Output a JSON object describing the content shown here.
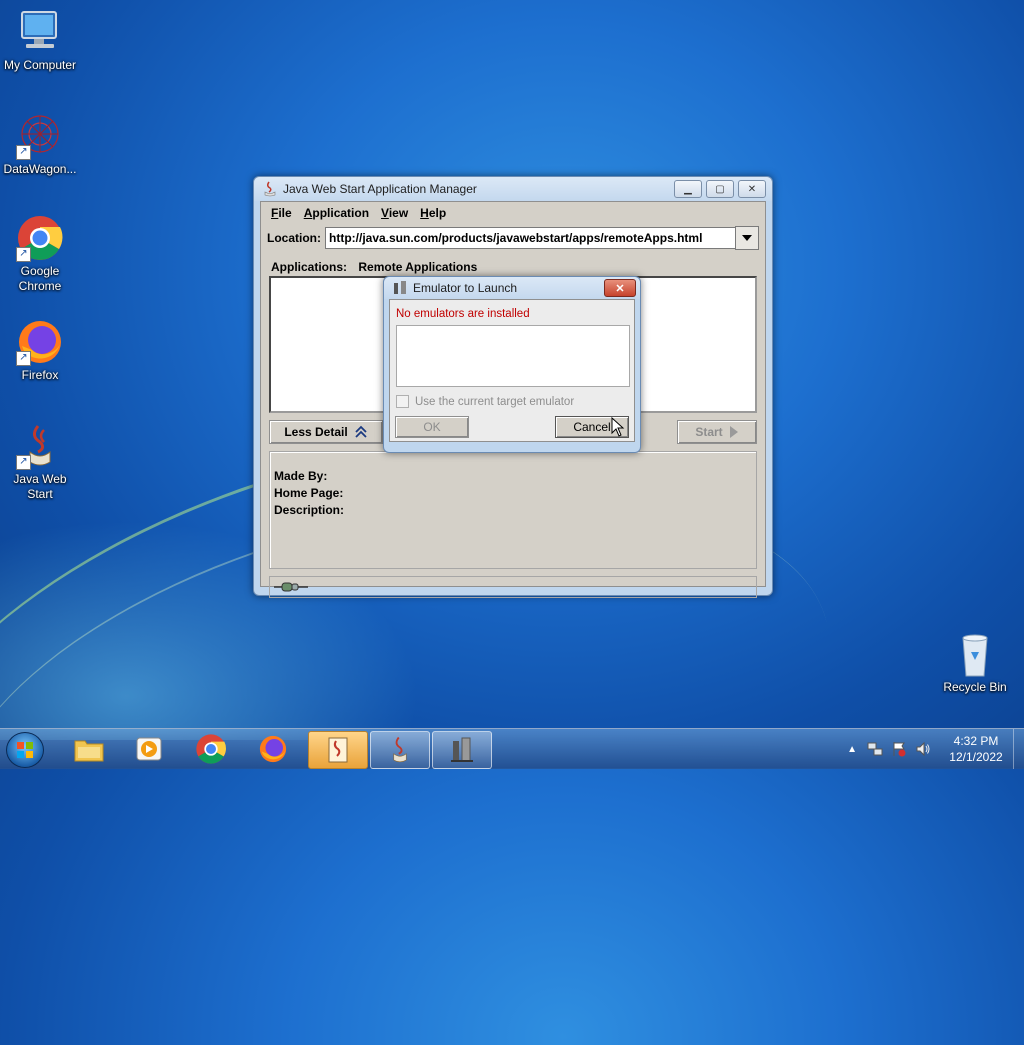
{
  "desktop": {
    "icons": [
      {
        "label": "My Computer"
      },
      {
        "label": "DataWagon..."
      },
      {
        "label": "Google Chrome"
      },
      {
        "label": "Firefox"
      },
      {
        "label": "Java Web Start"
      },
      {
        "label": "Recycle Bin"
      }
    ]
  },
  "jws": {
    "title": "Java Web Start Application Manager",
    "menus": [
      "File",
      "Application",
      "View",
      "Help"
    ],
    "location_label": "Location:",
    "location_value": "http://java.sun.com/products/javawebstart/apps/remoteApps.html",
    "applications_label": "Applications:",
    "applications_value": "Remote Applications",
    "less_detail_label": "Less Detail",
    "start_label": "Start",
    "made_by_label": "Made By:",
    "home_page_label": "Home Page:",
    "description_label": "Description:"
  },
  "dialog": {
    "title": "Emulator to Launch",
    "message": "No emulators are installed",
    "checkbox_label": "Use the current target emulator",
    "ok_label": "OK",
    "cancel_label": "Cancel"
  },
  "taskbar": {
    "time": "4:32 PM",
    "date": "12/1/2022"
  },
  "colors": {
    "error_text": "#c00000",
    "disabled_text": "#8d8d8d"
  }
}
